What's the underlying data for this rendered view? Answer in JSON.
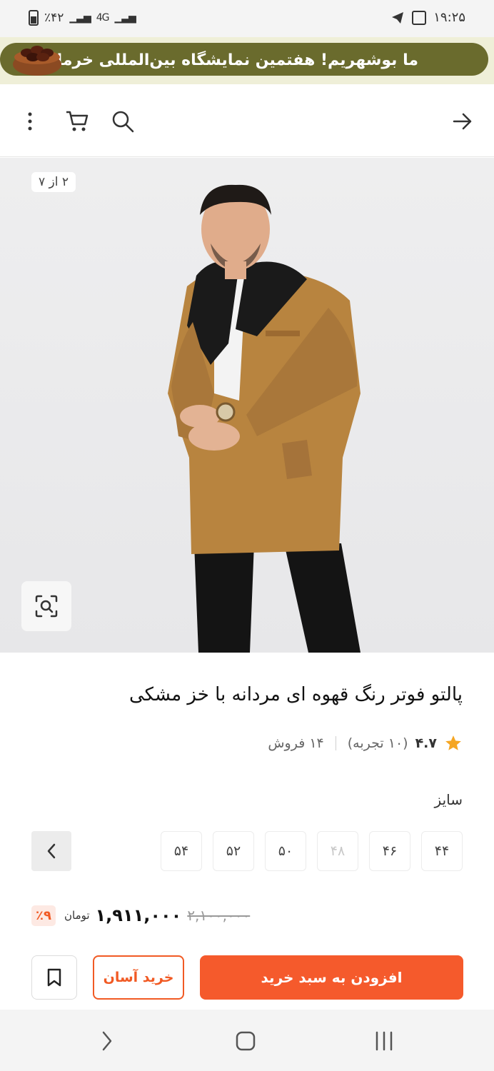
{
  "status_bar": {
    "time": "۱۹:۲۵",
    "battery": "٪۴۲",
    "network": "4G",
    "icons": [
      "telegram-icon",
      "gallery-icon",
      "battery-icon",
      "signal-icon"
    ]
  },
  "banner": {
    "text": "ما بوشهریم! هفتمین نمایشگاه بین‌المللی خرما",
    "background": "#6a6b2d"
  },
  "nav": {
    "icons": [
      "back-arrow-icon",
      "search-icon",
      "cart-icon",
      "more-menu-icon"
    ]
  },
  "gallery": {
    "counter": "۲ از ۷",
    "icons": [
      "zoom-search-icon"
    ]
  },
  "product": {
    "title": "پالتو فوتر رنگ قهوه ای مردانه با خز مشکی",
    "rating": "۴.۷",
    "reviews": "(۱۰ تجربه)",
    "sales": "۱۴ فروش",
    "size_label": "سایز",
    "sizes": [
      {
        "label": "۴۴",
        "available": true
      },
      {
        "label": "۴۶",
        "available": true
      },
      {
        "label": "۴۸",
        "available": false
      },
      {
        "label": "۵۰",
        "available": true
      },
      {
        "label": "۵۲",
        "available": true
      },
      {
        "label": "۵۴",
        "available": true
      }
    ],
    "price": {
      "current": "۱,۹۱۱,۰۰۰",
      "old": "۲,۱۰۰,۰۰۰",
      "currency": "تومان",
      "discount": "٪۹"
    }
  },
  "actions": {
    "add_to_cart": "افزودن به سبد خرید",
    "easy_buy": "خرید آسان",
    "accent": "#f55a2c"
  },
  "android_nav": {
    "icons": [
      "recent-apps-icon",
      "home-icon",
      "back-icon"
    ]
  }
}
